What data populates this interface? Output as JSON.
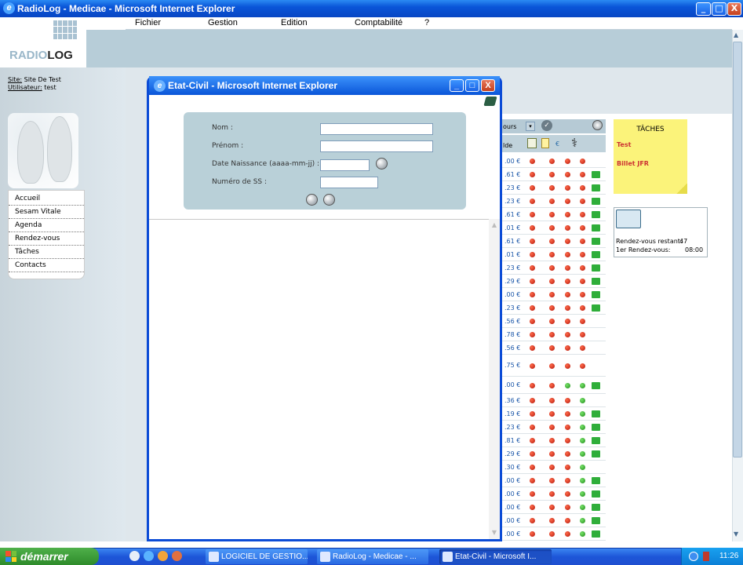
{
  "window": {
    "title": "RadioLog - Medicae - Microsoft Internet Explorer",
    "minimize": "_",
    "maximize": "□",
    "close": "X"
  },
  "logo": {
    "part1": "RADIO",
    "part2": "LOG"
  },
  "menu": [
    "Fichier",
    "Gestion",
    "Edition",
    "Comptabilité",
    "?"
  ],
  "site": {
    "label": "Site:",
    "value": "Site De Test",
    "user_label": "Utilisateur:",
    "user_value": "test"
  },
  "nav": [
    "Accueil",
    "Sesam Vitale",
    "Agenda",
    "Rendez-vous",
    "Tâches",
    "Contacts"
  ],
  "table": {
    "filter": "ours",
    "col_header": "lde",
    "rows": [
      {
        "amount": ".00 €",
        "dots": [
          "r",
          "r",
          "r",
          "r"
        ],
        "flag": false
      },
      {
        "amount": ".61 €",
        "dots": [
          "r",
          "r",
          "r",
          "r"
        ],
        "flag": true
      },
      {
        "amount": ".23 €",
        "dots": [
          "r",
          "r",
          "r",
          "r"
        ],
        "flag": true
      },
      {
        "amount": ".23 €",
        "dots": [
          "r",
          "r",
          "r",
          "r"
        ],
        "flag": true
      },
      {
        "amount": ".61 €",
        "dots": [
          "r",
          "r",
          "r",
          "r"
        ],
        "flag": true
      },
      {
        "amount": ".01 €",
        "dots": [
          "r",
          "r",
          "r",
          "r"
        ],
        "flag": true
      },
      {
        "amount": ".61 €",
        "dots": [
          "r",
          "r",
          "r",
          "r"
        ],
        "flag": true
      },
      {
        "amount": ".01 €",
        "dots": [
          "r",
          "r",
          "r",
          "r"
        ],
        "flag": true
      },
      {
        "amount": ".23 €",
        "dots": [
          "r",
          "r",
          "r",
          "r"
        ],
        "flag": true
      },
      {
        "amount": ".29 €",
        "dots": [
          "r",
          "r",
          "r",
          "r"
        ],
        "flag": true
      },
      {
        "amount": ".00 €",
        "dots": [
          "r",
          "r",
          "r",
          "r"
        ],
        "flag": true
      },
      {
        "amount": ".23 €",
        "dots": [
          "r",
          "r",
          "r",
          "r"
        ],
        "flag": true
      },
      {
        "amount": ".56 €",
        "dots": [
          "r",
          "r",
          "r",
          "r"
        ],
        "flag": false
      },
      {
        "amount": ".78 €",
        "dots": [
          "r",
          "r",
          "r",
          "r"
        ],
        "flag": false
      },
      {
        "amount": ".56 €",
        "dots": [
          "r",
          "r",
          "r",
          "r"
        ],
        "flag": false
      },
      {
        "amount": ".75 €",
        "dots": [
          "r",
          "r",
          "r",
          "r"
        ],
        "flag": false
      },
      {
        "amount": ".00 €",
        "dots": [
          "r",
          "r",
          "g",
          "g"
        ],
        "flag": true
      },
      {
        "amount": ".36 €",
        "dots": [
          "r",
          "r",
          "r",
          "g"
        ],
        "flag": false
      },
      {
        "amount": ".19 €",
        "dots": [
          "r",
          "r",
          "r",
          "g"
        ],
        "flag": true
      },
      {
        "amount": ".23 €",
        "dots": [
          "r",
          "r",
          "r",
          "g"
        ],
        "flag": true
      },
      {
        "amount": ".81 €",
        "dots": [
          "r",
          "r",
          "r",
          "g"
        ],
        "flag": true
      },
      {
        "amount": ".29 €",
        "dots": [
          "r",
          "r",
          "r",
          "g"
        ],
        "flag": true
      },
      {
        "amount": ".30 €",
        "dots": [
          "r",
          "r",
          "r",
          "g"
        ],
        "flag": false
      },
      {
        "amount": ".00 €",
        "dots": [
          "r",
          "r",
          "r",
          "g"
        ],
        "flag": true
      },
      {
        "amount": ".00 €",
        "dots": [
          "r",
          "r",
          "r",
          "g"
        ],
        "flag": true
      },
      {
        "amount": ".00 €",
        "dots": [
          "r",
          "r",
          "r",
          "g"
        ],
        "flag": true
      },
      {
        "amount": ".00 €",
        "dots": [
          "r",
          "r",
          "r",
          "g"
        ],
        "flag": true
      },
      {
        "amount": ".00 €",
        "dots": [
          "r",
          "r",
          "r",
          "g"
        ],
        "flag": true
      }
    ]
  },
  "tasks": {
    "title": "TÂCHES",
    "items": [
      "Test",
      "Billet JFR"
    ]
  },
  "rdv": {
    "remaining_label": "Rendez-vous restant:",
    "remaining_value": "47",
    "first_label": "1er Rendez-vous:",
    "first_value": "08:00"
  },
  "popup": {
    "title": "Etat-Civil - Microsoft Internet Explorer",
    "fields": [
      {
        "label": "Nom :",
        "value": ""
      },
      {
        "label": "Prénom :",
        "value": ""
      },
      {
        "label": "Date Naissance (aaaa-mm-jj) :",
        "value": ""
      },
      {
        "label": "Numéro de SS :",
        "value": ""
      }
    ]
  },
  "taskbar": {
    "start": "démarrer",
    "tasks": [
      "LOGICIEL DE GESTIO...",
      "RadioLog - Medicae - ...",
      "Etat-Civil - Microsoft I..."
    ],
    "clock": "11:26"
  },
  "colors": {
    "title_blue": "#0a55d8",
    "start_green": "#3a9d36",
    "tasks_yellow": "#fbf37a",
    "panel_band": "#b7cdd8"
  }
}
